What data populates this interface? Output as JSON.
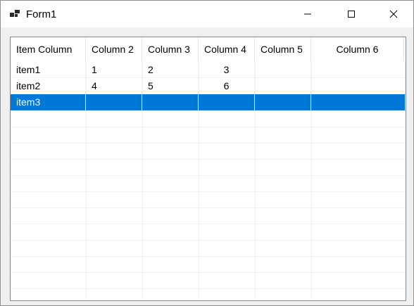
{
  "window": {
    "title": "Form1"
  },
  "icons": {
    "app": "app-form-icon",
    "minimize": "minimize-icon",
    "maximize": "maximize-icon",
    "close": "close-icon"
  },
  "listview": {
    "columns": [
      "Item Column",
      "Column 2",
      "Column 3",
      "Column 4",
      "Column 5",
      "Column 6"
    ],
    "rows": [
      [
        "item1",
        "1",
        "2",
        "3",
        "",
        ""
      ],
      [
        "item2",
        "4",
        "5",
        "6",
        "",
        ""
      ],
      [
        "item3",
        "",
        "",
        "",
        "",
        ""
      ]
    ],
    "selected_row": 2,
    "selection_color": "#0078d7"
  }
}
